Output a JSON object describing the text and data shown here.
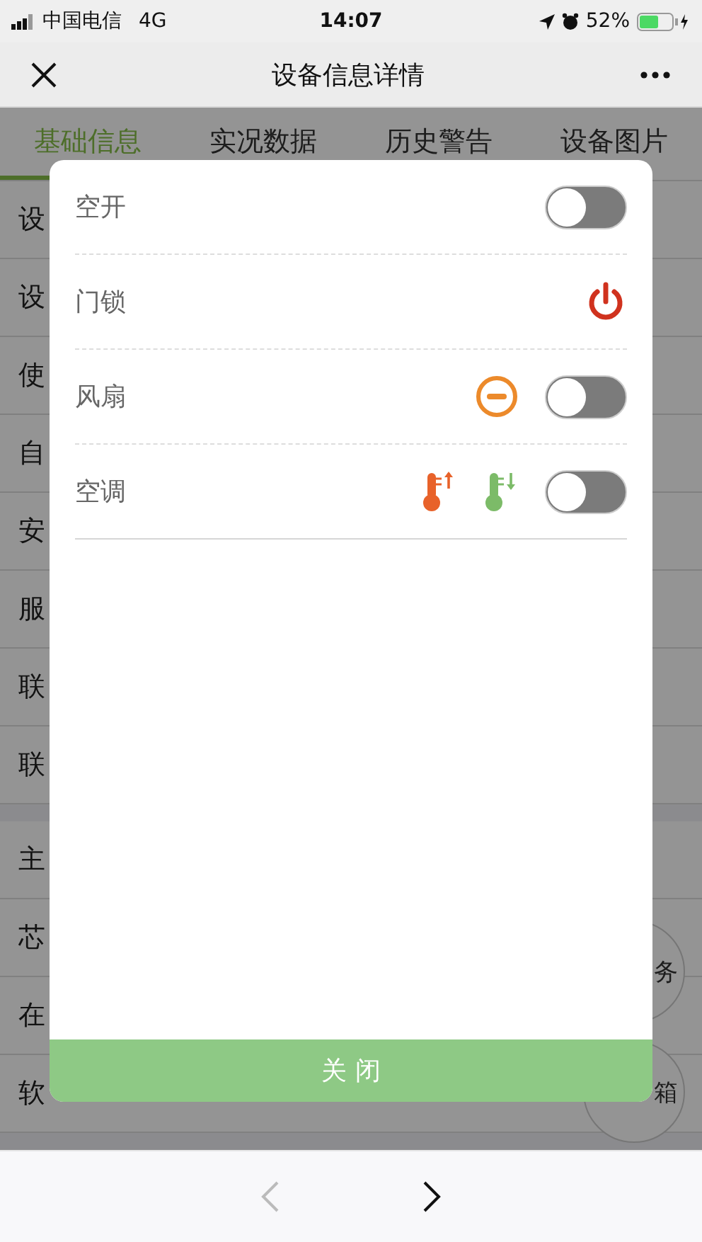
{
  "status_bar": {
    "carrier": "中国电信",
    "network": "4G",
    "time": "14:07",
    "battery": "52%"
  },
  "nav": {
    "title": "设备信息详情"
  },
  "tabs": [
    {
      "label": "基础信息",
      "selected": true
    },
    {
      "label": "实况数据",
      "selected": false
    },
    {
      "label": "历史警告",
      "selected": false
    },
    {
      "label": "设备图片",
      "selected": false
    }
  ],
  "sections": [
    {
      "rows": [
        "设",
        "设",
        "使",
        "自",
        "安",
        "服",
        "联",
        "联"
      ]
    },
    {
      "rows": [
        "主",
        "芯",
        "在",
        "软"
      ]
    }
  ],
  "float_buttons": [
    "务",
    "箱"
  ],
  "dialog": {
    "items": [
      {
        "label": "空开",
        "actions": [
          {
            "kind": "switch",
            "on": false
          }
        ]
      },
      {
        "label": "门锁",
        "actions": [
          {
            "kind": "power"
          }
        ]
      },
      {
        "label": "风扇",
        "actions": [
          {
            "kind": "stop"
          },
          {
            "kind": "switch",
            "on": false
          }
        ]
      },
      {
        "label": "空调",
        "actions": [
          {
            "kind": "temp-up"
          },
          {
            "kind": "temp-down"
          },
          {
            "kind": "switch",
            "on": false
          }
        ]
      }
    ],
    "close_button": "关 闭"
  },
  "bottom_nav": {
    "back_disabled": true,
    "forward_disabled": false
  }
}
